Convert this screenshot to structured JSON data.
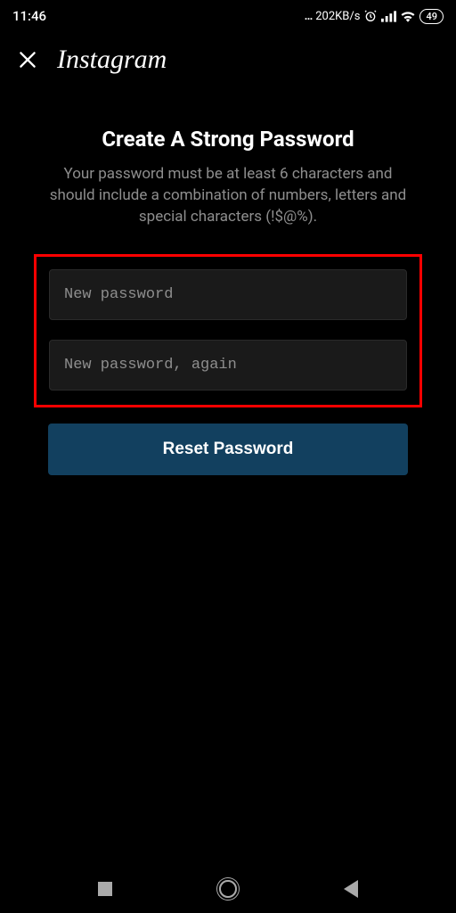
{
  "status": {
    "time": "11:46",
    "net_speed": "202KB/s",
    "battery": "49"
  },
  "header": {
    "brand": "Instagram"
  },
  "page": {
    "title": "Create A Strong Password",
    "subtitle": "Your password must be at least 6 characters and should include a combination of numbers, letters and special characters (!$@%)."
  },
  "form": {
    "new_password_placeholder": "New password",
    "new_password_again_placeholder": "New password, again",
    "reset_button": "Reset Password"
  }
}
